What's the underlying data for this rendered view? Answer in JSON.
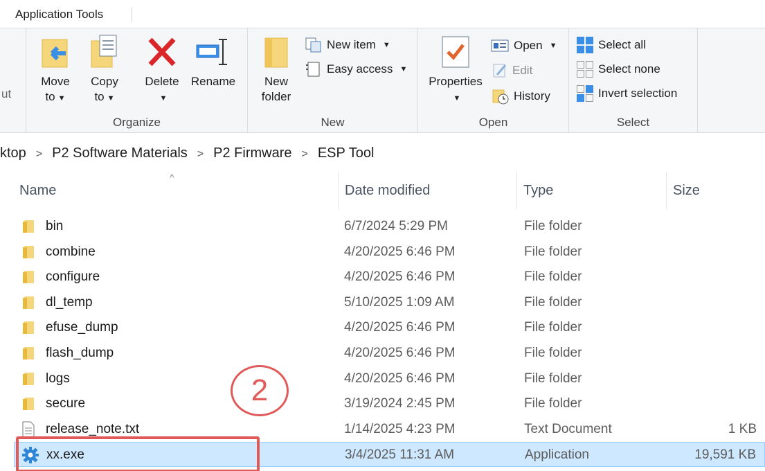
{
  "tabstrip": {
    "app_tools": "Application Tools"
  },
  "ribbon": {
    "cut_fragment": "ut",
    "organize": {
      "label": "Organize",
      "move_to": [
        "Move",
        "to"
      ],
      "copy_to": [
        "Copy",
        "to"
      ],
      "delete": "Delete",
      "rename": "Rename"
    },
    "new": {
      "label": "New",
      "new_folder": [
        "New",
        "folder"
      ],
      "new_item": "New item",
      "easy_access": "Easy access"
    },
    "open": {
      "label": "Open",
      "properties": "Properties",
      "open": "Open",
      "edit": "Edit",
      "history": "History"
    },
    "select": {
      "label": "Select",
      "select_all": "Select all",
      "select_none": "Select none",
      "invert_selection": "Invert selection"
    }
  },
  "breadcrumb": [
    "ktop",
    "P2 Software Materials",
    "P2 Firmware",
    "ESP Tool"
  ],
  "columns": {
    "name": "Name",
    "date": "Date modified",
    "type": "Type",
    "size": "Size"
  },
  "files": [
    {
      "name": "bin",
      "date": "6/7/2024 5:29 PM",
      "type": "File folder",
      "size": "",
      "icon": "folder-icon"
    },
    {
      "name": "combine",
      "date": "4/20/2025 6:46 PM",
      "type": "File folder",
      "size": "",
      "icon": "folder-icon"
    },
    {
      "name": "configure",
      "date": "4/20/2025 6:46 PM",
      "type": "File folder",
      "size": "",
      "icon": "folder-icon"
    },
    {
      "name": "dl_temp",
      "date": "5/10/2025 1:09 AM",
      "type": "File folder",
      "size": "",
      "icon": "folder-icon"
    },
    {
      "name": "efuse_dump",
      "date": "4/20/2025 6:46 PM",
      "type": "File folder",
      "size": "",
      "icon": "folder-icon"
    },
    {
      "name": "flash_dump",
      "date": "4/20/2025 6:46 PM",
      "type": "File folder",
      "size": "",
      "icon": "folder-icon"
    },
    {
      "name": "logs",
      "date": "4/20/2025 6:46 PM",
      "type": "File folder",
      "size": "",
      "icon": "folder-icon"
    },
    {
      "name": "secure",
      "date": "3/19/2024 2:45 PM",
      "type": "File folder",
      "size": "",
      "icon": "folder-icon"
    },
    {
      "name": "release_note.txt",
      "date": "1/14/2025 4:23 PM",
      "type": "Text Document",
      "size": "1 KB",
      "icon": "text-file-icon"
    },
    {
      "name": "xx.exe",
      "date": "3/4/2025 11:31 AM",
      "type": "Application",
      "size": "19,591 KB",
      "icon": "gear-icon",
      "selected": true
    }
  ],
  "annotation": {
    "step": "2"
  },
  "colors": {
    "selection": "#cde8ff",
    "annotation": "#e05a5a",
    "folder": "#f4c430"
  }
}
